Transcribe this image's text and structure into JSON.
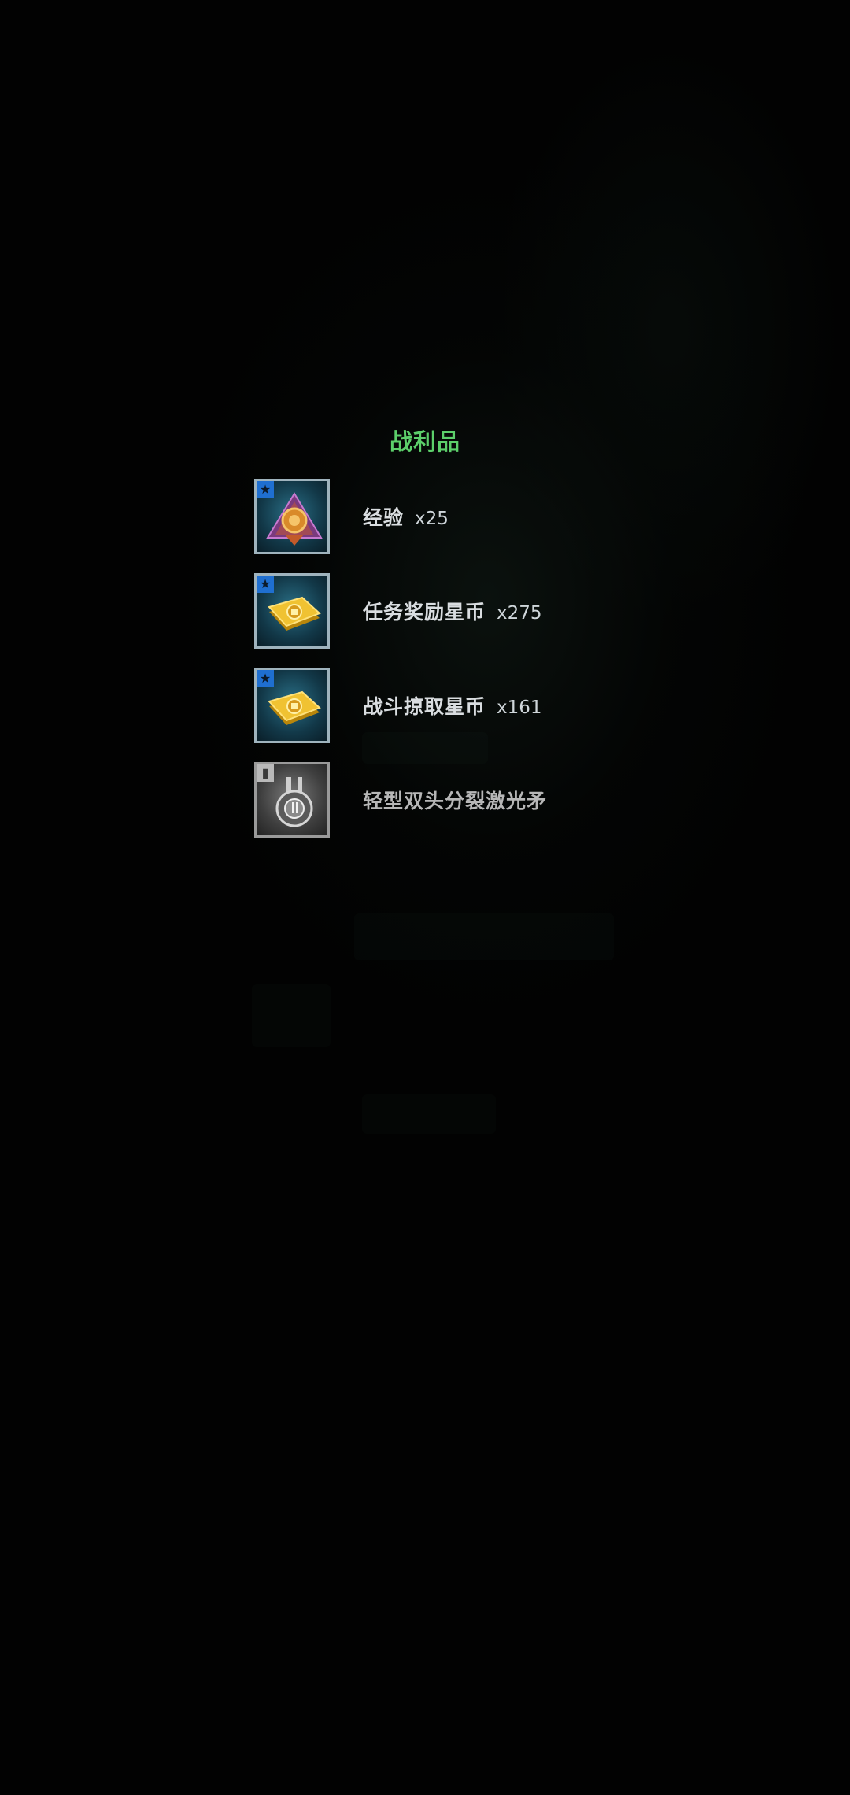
{
  "loot_panel": {
    "title": "战利品",
    "items": [
      {
        "name": "经验",
        "qty": "x25",
        "icon": "experience-medal-icon",
        "rarity_icon": "star-icon",
        "frame": "blue"
      },
      {
        "name": "任务奖励星币",
        "qty": "x275",
        "icon": "star-coin-icon",
        "rarity_icon": "star-icon",
        "frame": "blue"
      },
      {
        "name": "战斗掠取星币",
        "qty": "x161",
        "icon": "star-coin-icon",
        "rarity_icon": "star-icon",
        "frame": "blue"
      },
      {
        "name": "轻型双头分裂激光矛",
        "qty": "",
        "icon": "laser-spear-module-icon",
        "rarity_icon": "module-icon",
        "frame": "gray"
      }
    ]
  },
  "colors": {
    "title": "#5ccf6a",
    "background": "#020202",
    "blue_frame": "#2a6f86",
    "gray_frame": "#7a7a7a"
  }
}
